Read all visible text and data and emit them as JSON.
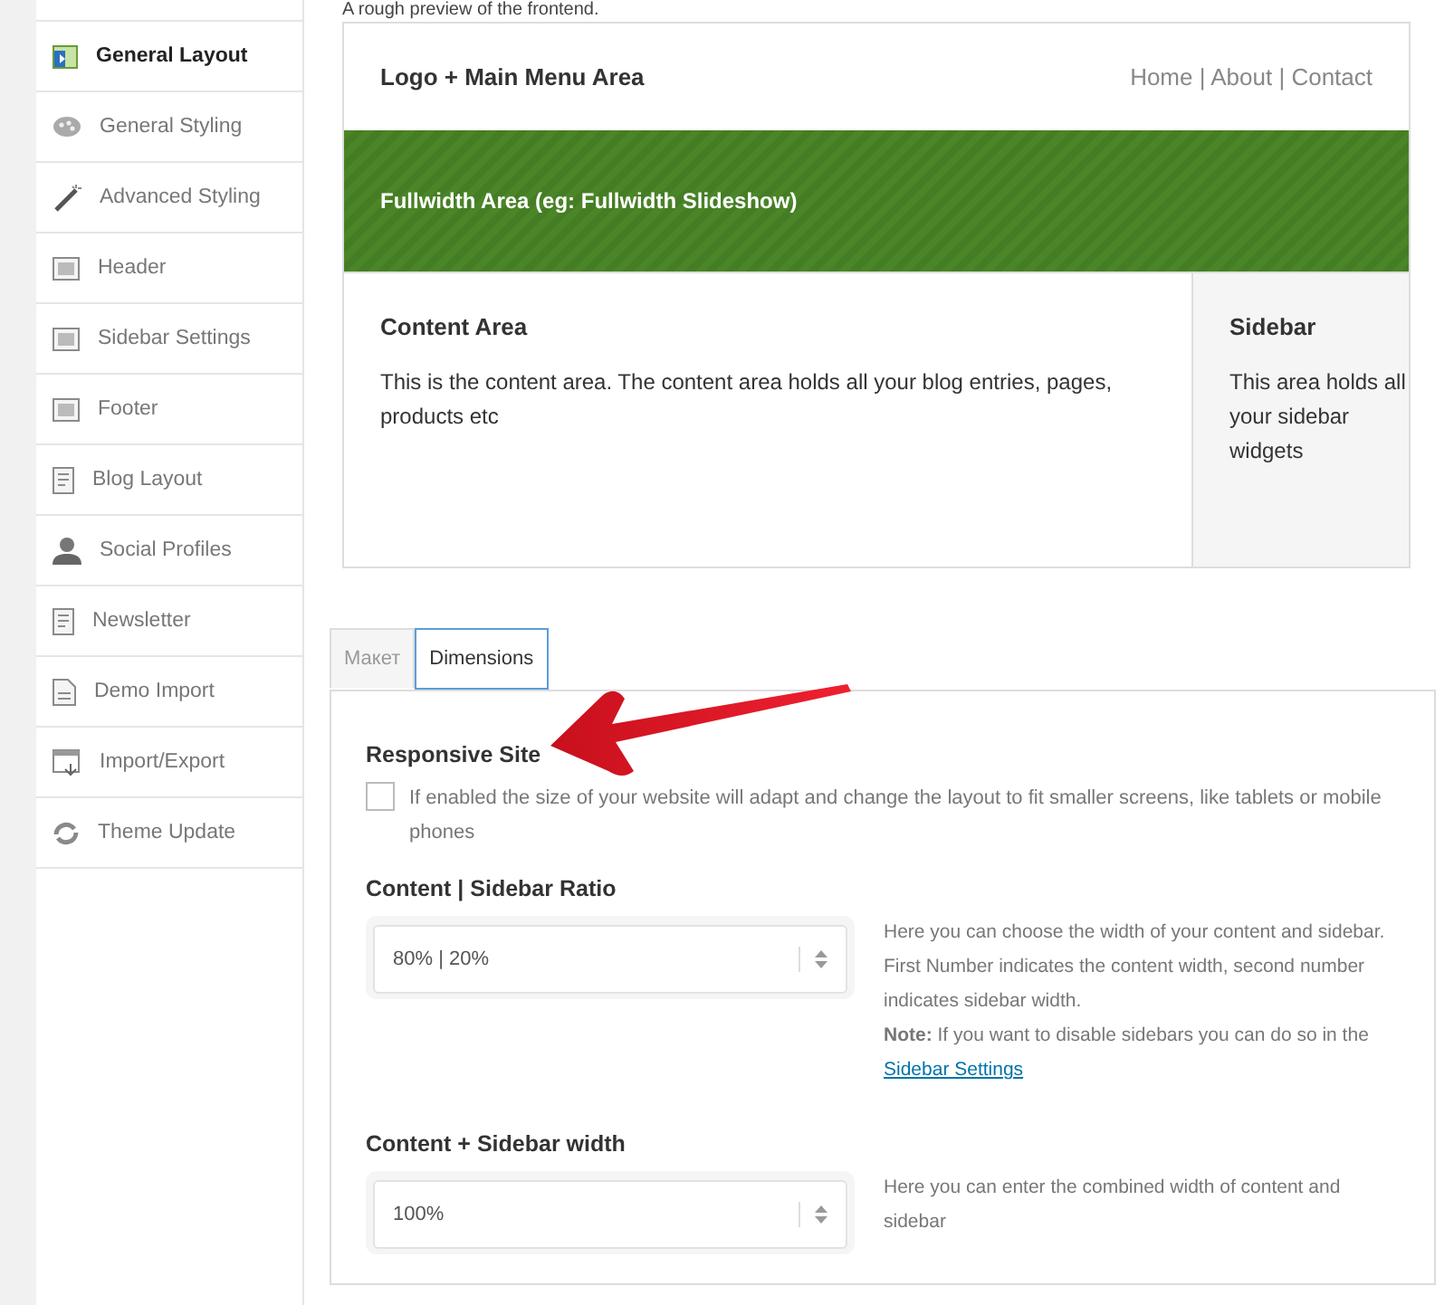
{
  "sidebar": {
    "items": [
      {
        "label": "General Layout",
        "selected": true
      },
      {
        "label": "General Styling",
        "selected": false
      },
      {
        "label": "Advanced Styling",
        "selected": false
      },
      {
        "label": "Header",
        "selected": false
      },
      {
        "label": "Sidebar Settings",
        "selected": false
      },
      {
        "label": "Footer",
        "selected": false
      },
      {
        "label": "Blog Layout",
        "selected": false
      },
      {
        "label": "Social Profiles",
        "selected": false
      },
      {
        "label": "Newsletter",
        "selected": false
      },
      {
        "label": "Demo Import",
        "selected": false
      },
      {
        "label": "Import/Export",
        "selected": false
      },
      {
        "label": "Theme Update",
        "selected": false
      }
    ]
  },
  "preview": {
    "caption": "A rough preview of the frontend.",
    "logo_area": "Logo + Main Menu Area",
    "menu": "Home | About | Contact",
    "fullwidth_area": "Fullwidth Area (eg: Fullwidth Slideshow)",
    "content_title": "Content Area",
    "content_text": "This is the content area. The content area holds all your blog entries, pages, products etc",
    "sidebar_title": "Sidebar",
    "sidebar_text": "This area holds all your sidebar widgets"
  },
  "tabs": [
    {
      "label": "Макет",
      "selected": false
    },
    {
      "label": "Dimensions",
      "selected": true
    }
  ],
  "responsive": {
    "title": "Responsive Site",
    "checked": false,
    "text": "If enabled the size of your website will adapt and change the layout to fit smaller screens, like tablets or mobile phones"
  },
  "fields": [
    {
      "label": "Content | Sidebar Ratio",
      "value": "80% | 20%",
      "description": "Here you can choose the width of your content and sidebar. First Number indicates the content width, second number indicates sidebar width.",
      "note": "**Note:** If you want to disable sidebars you can do so in the",
      "link": "Sidebar Settings"
    },
    {
      "label": "Content + Sidebar width",
      "value": "100%",
      "description": "Here you can enter the combined width of content and sidebar"
    }
  ]
}
